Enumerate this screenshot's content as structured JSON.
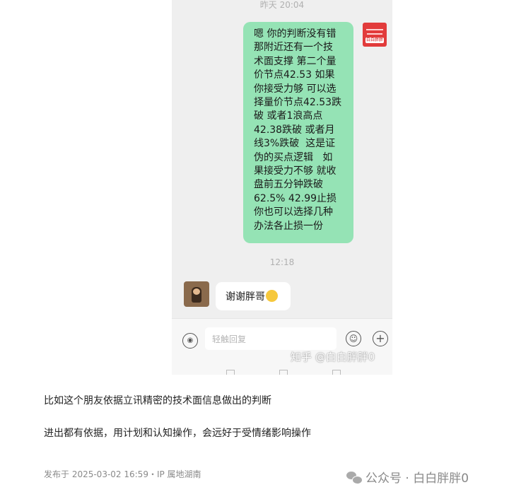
{
  "chat": {
    "timestamp_top": "昨天 20:04",
    "my_message": "嗯 你的判断没有错\n那附近还有一个技\n术面支撑 第二个量\n价节点42.53 如果\n你接受力够 可以选\n择量价节点42.53跌\n破 或者1浪高点\n42.38跌破 或者月\n线3%跌破  这是证\n伪的买点逻辑   如\n果接受力不够 就收\n盘前五分钟跌破\n62.5% 42.99止损\n你也可以选择几种\n办法各止损一份",
    "my_avatar_tag": "白白胖胖",
    "timestamp_mid": "12:18",
    "reply_message": "谢谢胖哥",
    "input_placeholder": "轻触回复",
    "watermark": "知乎 @白白胖胖0"
  },
  "article": {
    "paragraph_1": "比如这个朋友依据立讯精密的技术面信息做出的判断",
    "paragraph_2": "进出都有依据，用计划和认知操作，会远好于受情绪影响操作",
    "publish_meta": "发布于 2025-03-02 16:59・IP 属地湖南",
    "wechat_label": "公众号 · 白白胖胖0"
  },
  "icons": [
    "voice-icon",
    "emoji-icon",
    "plus-icon",
    "smile-emoji-icon",
    "wechat-icon"
  ],
  "colors": {
    "my_bubble": "#95e3b5",
    "chat_bg": "#efefef"
  }
}
